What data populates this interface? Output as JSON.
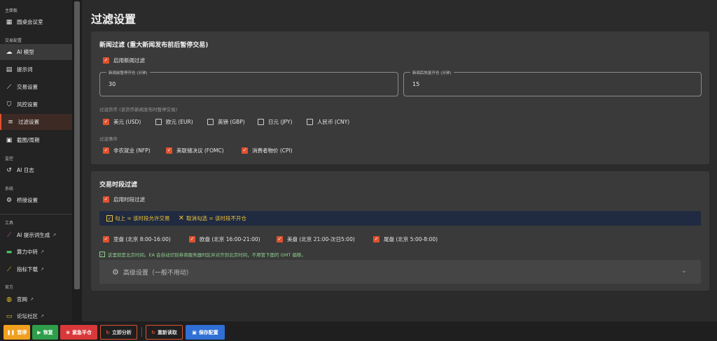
{
  "sidebar": {
    "sections": {
      "main": "主面板",
      "trade": "交易配置",
      "monitor": "监控",
      "system": "系统",
      "tools": "工具",
      "official": "官方"
    },
    "items": [
      {
        "label": "圆桌会议室",
        "icon": "grid-icon"
      },
      {
        "label": "AI 模型",
        "icon": "robot-icon"
      },
      {
        "label": "提示词",
        "icon": "document-icon"
      },
      {
        "label": "交易设置",
        "icon": "chart-line-icon"
      },
      {
        "label": "风控设置",
        "icon": "shield-icon"
      },
      {
        "label": "过滤设置",
        "icon": "filter-icon"
      },
      {
        "label": "截图/周期",
        "icon": "image-stack-icon"
      },
      {
        "label": "AI 日志",
        "icon": "history-icon"
      },
      {
        "label": "桥接设置",
        "icon": "gear-icon"
      },
      {
        "label": "AI 提示词生成",
        "icon": "magic-wand-icon"
      },
      {
        "label": "算力中转",
        "icon": "money-icon"
      },
      {
        "label": "指标下载",
        "icon": "trend-icon"
      },
      {
        "label": "官网",
        "icon": "globe-icon"
      },
      {
        "label": "论坛社区",
        "icon": "chat-icon"
      }
    ]
  },
  "page": {
    "title": "过滤设置"
  },
  "news": {
    "title": "新闻过滤 (重大新闻发布前后暂停交易)",
    "enable_label": "启用新闻过滤",
    "pause_before_label": "新闻前暂停开仓 (分钟)",
    "pause_before_value": "30",
    "resume_after_label": "新闻后恢复开仓 (分钟)",
    "resume_after_value": "15",
    "currency_hint": "过滤货币 (该货币新闻发布时暂停交易)",
    "currencies": [
      {
        "label": "美元 (USD)",
        "checked": true
      },
      {
        "label": "欧元 (EUR)",
        "checked": false
      },
      {
        "label": "英镑 (GBP)",
        "checked": false
      },
      {
        "label": "日元 (JPY)",
        "checked": false
      },
      {
        "label": "人民币 (CNY)",
        "checked": false
      }
    ],
    "event_hint": "过滤事件",
    "events": [
      {
        "label": "非农就业 (NFP)",
        "checked": true
      },
      {
        "label": "美联储决议 (FOMC)",
        "checked": true
      },
      {
        "label": "消费者物价 (CPI)",
        "checked": true
      }
    ]
  },
  "session": {
    "title": "交易时段过滤",
    "enable_label": "启用时段过滤",
    "banner_allow": "勾上 = 该时段允许交易",
    "banner_deny": "取消勾选 = 该时段不开仓",
    "sessions": [
      {
        "label": "亚盘 (北京 8:00-16:00)",
        "checked": true
      },
      {
        "label": "欧盘 (北京 16:00-21:00)",
        "checked": true
      },
      {
        "label": "美盘 (北京 21:00-次日5:00)",
        "checked": true
      },
      {
        "label": "尾盘 (北京 5:00-8:00)",
        "checked": true
      }
    ],
    "note": "这里就是北京时间。EA 会自动识别券商服务器时区并对齐到北京时间，不用管下面的 GMT 偏移。",
    "advanced_label": "高级设置（一般不用动）"
  },
  "bottom": {
    "pause": "暂停",
    "resume": "恢复",
    "emergency": "紧急平仓",
    "analyze": "立即分析",
    "reload": "重新读取",
    "save": "保存配置"
  },
  "colors": {
    "accent": "#e0522f",
    "pause_btn": "#f0a01e",
    "resume_btn": "#2e9e4a",
    "emergency_btn": "#d9383a",
    "save_btn": "#2f6fd6"
  }
}
